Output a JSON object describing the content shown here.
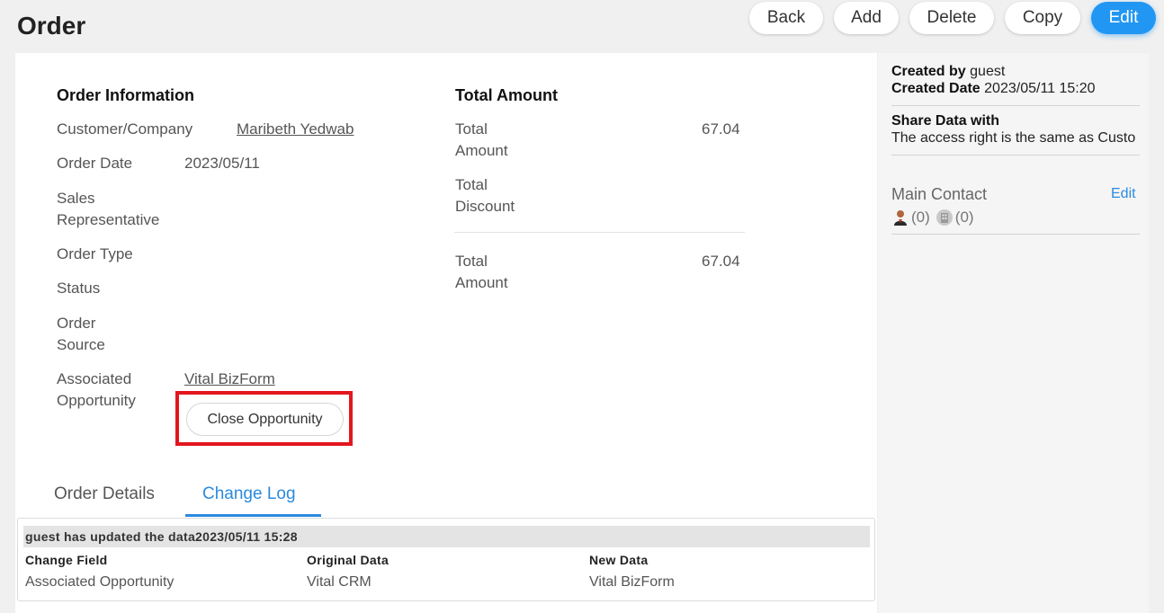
{
  "page": {
    "title": "Order"
  },
  "toolbar": {
    "back": "Back",
    "add": "Add",
    "delete": "Delete",
    "copy": "Copy",
    "edit": "Edit",
    "accent": "#2196f3"
  },
  "order_info": {
    "title": "Order Information",
    "customer_label": "Customer/Company",
    "customer_value": "Maribeth Yedwab",
    "order_date_label": "Order Date",
    "order_date_value": "2023/05/11",
    "sales_rep_label_1": "Sales",
    "sales_rep_label_2": "Representative",
    "order_type_label": "Order Type",
    "status_label": "Status",
    "order_source_label_1": "Order",
    "order_source_label_2": "Source",
    "assoc_opp_label_1": "Associated",
    "assoc_opp_label_2": "Opportunity",
    "assoc_opp_value": "Vital BizForm",
    "close_opp_button": "Close Opportunity",
    "highlight_color": "#e3161d"
  },
  "total_amount": {
    "title": "Total Amount",
    "total_amount_label_1": "Total",
    "total_amount_label_2": "Amount",
    "total_amount_value": "67.04",
    "total_discount_label_1": "Total",
    "total_discount_label_2": "Discount",
    "grand_total_label_1": "Total",
    "grand_total_label_2": "Amount",
    "grand_total_value": "67.04"
  },
  "tabs": {
    "order_details": "Order Details",
    "change_log": "Change Log",
    "active_color": "#2b8ae0"
  },
  "change_log": {
    "header": "guest has updated the data2023/05/11 15:28",
    "col_field": "Change Field",
    "col_original": "Original Data",
    "col_new": "New Data",
    "row_field": "Associated Opportunity",
    "row_original": "Vital CRM",
    "row_new": "Vital BizForm"
  },
  "side_panel": {
    "created_by_label": "Created by",
    "created_by_value": "guest",
    "created_date_label": "Created Date",
    "created_date_value": "2023/05/11 15:20",
    "share_label": "Share Data with",
    "share_value": "The access right is the same as Custo",
    "main_contact": "Main Contact",
    "edit": "Edit",
    "person_count": "(0)",
    "company_count": "(0)",
    "person_icon": "person-icon",
    "company_icon": "building-icon"
  }
}
